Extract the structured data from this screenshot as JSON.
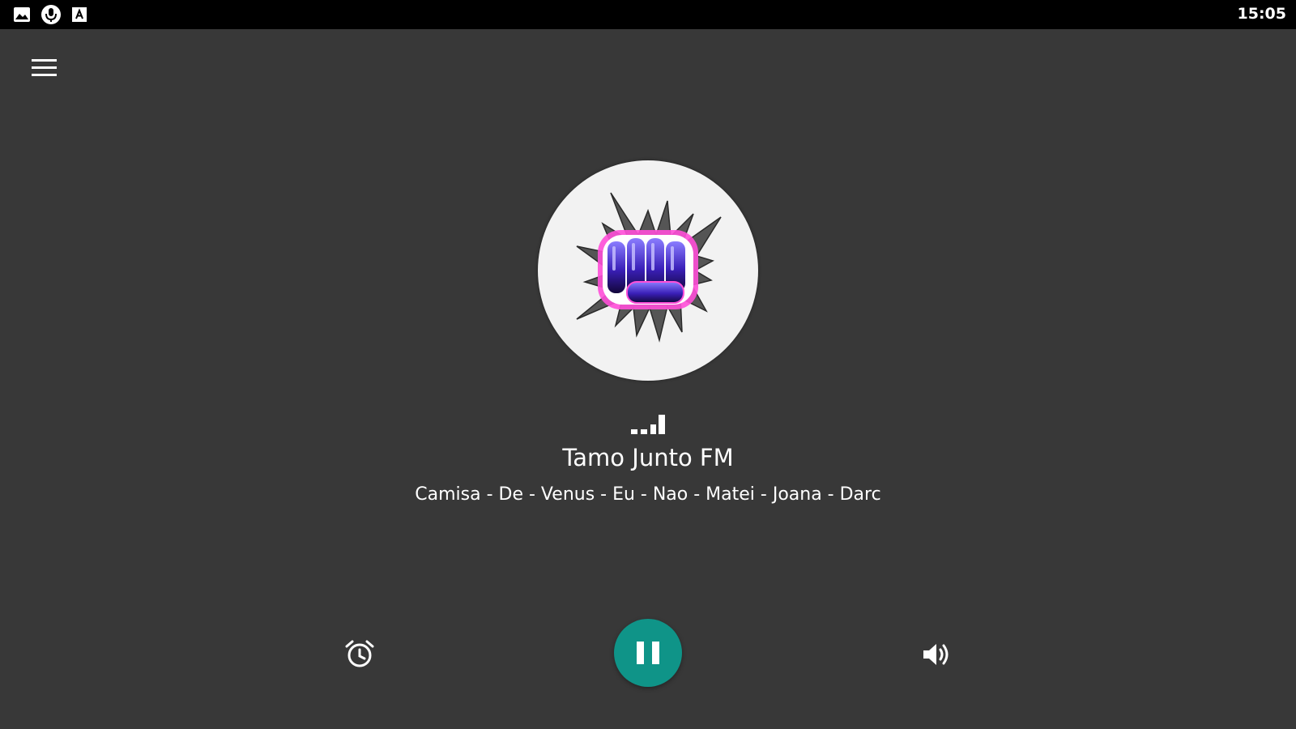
{
  "status_bar": {
    "time": "15:05",
    "icons": [
      "image-icon",
      "mic-icon",
      "a-box-icon"
    ]
  },
  "toolbar": {
    "menu_icon": "hamburger-menu-icon"
  },
  "player": {
    "logo_icon": "fist-explosion-logo",
    "signal_icon": "signal-bars-icon",
    "station_name": "Tamo Junto FM",
    "now_playing": "Camisa - De - Venus - Eu - Nao - Matei - Joana - Darc"
  },
  "controls": {
    "alarm_icon": "alarm-clock-icon",
    "pause_icon": "pause-icon",
    "volume_icon": "volume-icon"
  },
  "colors": {
    "background": "#383838",
    "status_bar": "#000000",
    "accent": "#0f9488",
    "logo_background": "#f2f2f2"
  }
}
